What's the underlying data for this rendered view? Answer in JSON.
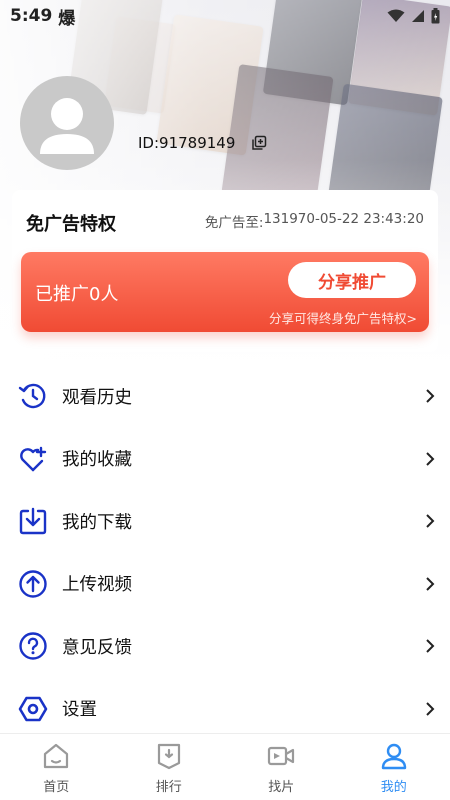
{
  "status_bar": {
    "time": "5:49",
    "app_glyph": "爆"
  },
  "profile": {
    "user_id": "ID:91789149"
  },
  "ad_card": {
    "title": "免广告特权",
    "expire_label": "免广告至:",
    "expire_value": "131970-05-22 23:43:20",
    "promo_count": "已推广0人",
    "share_button": "分享推广",
    "share_hint": "分享可得终身免广告特权>"
  },
  "menu": {
    "items": [
      {
        "label": "观看历史",
        "icon": "history-icon"
      },
      {
        "label": "我的收藏",
        "icon": "favorite-heart-icon"
      },
      {
        "label": "我的下载",
        "icon": "download-icon"
      },
      {
        "label": "上传视频",
        "icon": "upload-icon"
      },
      {
        "label": "意见反馈",
        "icon": "feedback-question-icon"
      },
      {
        "label": "设置",
        "icon": "settings-hexagon-icon"
      }
    ]
  },
  "bottom_nav": {
    "items": [
      {
        "label": "首页",
        "icon": "home-icon",
        "active": false
      },
      {
        "label": "排行",
        "icon": "ranking-icon",
        "active": false
      },
      {
        "label": "找片",
        "icon": "video-camera-icon",
        "active": false
      },
      {
        "label": "我的",
        "icon": "profile-icon",
        "active": true
      }
    ]
  },
  "colors": {
    "accent_blue": "#1a33c7",
    "promo_red": "#f04b34",
    "nav_active": "#2f8df3",
    "nav_inactive": "#9a9a9a"
  }
}
